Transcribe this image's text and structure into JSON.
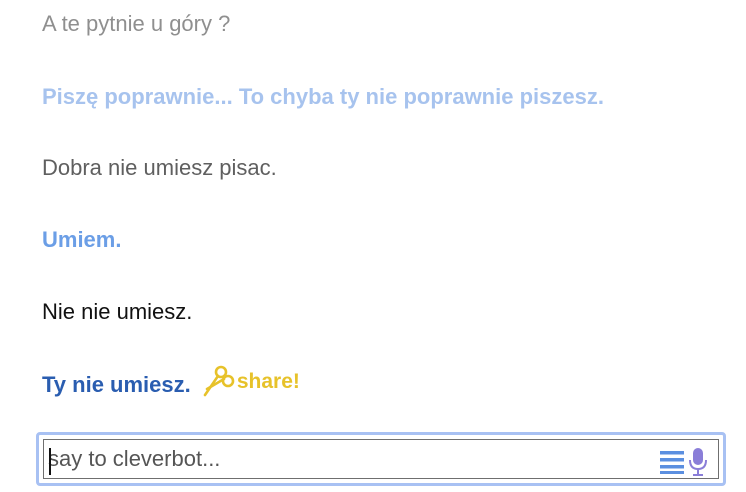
{
  "conversation": [
    {
      "speaker": "user",
      "text": "A te pytnie u góry ?"
    },
    {
      "speaker": "bot",
      "text": "Piszę poprawnie... To chyba ty nie poprawnie piszesz."
    },
    {
      "speaker": "user",
      "text": "Dobra nie umiesz pisac."
    },
    {
      "speaker": "bot",
      "text": "Umiem."
    },
    {
      "speaker": "user",
      "text": "Nie nie umiesz."
    },
    {
      "speaker": "bot",
      "text": "Ty nie umiesz."
    }
  ],
  "share": {
    "label": "share!",
    "icon": "scissors-icon",
    "color": "#e7c22a"
  },
  "input": {
    "placeholder": "say to cleverbot...",
    "value": ""
  },
  "icons": {
    "menu": "menu-icon",
    "mic": "microphone-icon"
  },
  "colors": {
    "accent": "#a8c1f3",
    "bot_latest": "#2a5db0",
    "bot_old": "#6b9ee6"
  }
}
